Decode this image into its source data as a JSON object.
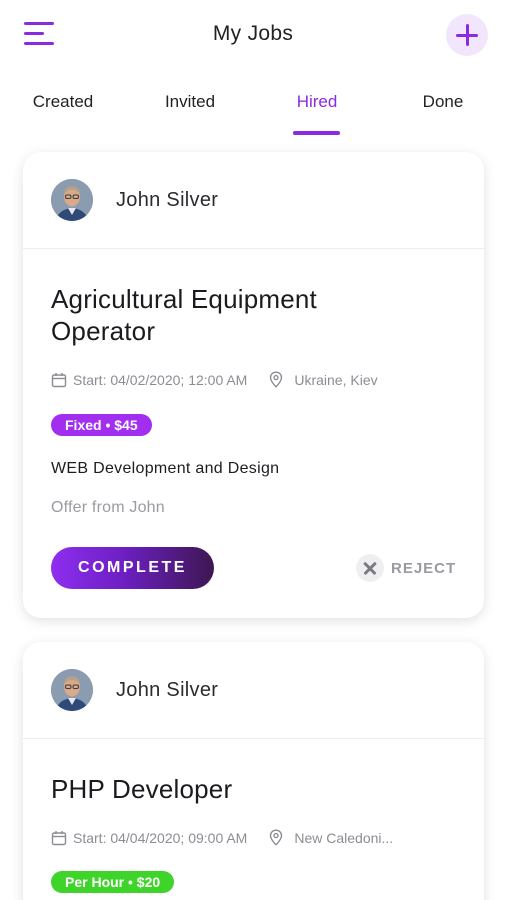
{
  "header": {
    "title": "My Jobs",
    "menu_icon": "hamburger-menu-icon",
    "add_icon": "plus-icon",
    "accent_color": "#8a2be2"
  },
  "tabs": [
    {
      "label": "Created",
      "active": false
    },
    {
      "label": "Invited",
      "active": false
    },
    {
      "label": "Hired",
      "active": true
    },
    {
      "label": "Done",
      "active": false
    }
  ],
  "jobs": [
    {
      "client_name": "John Silver",
      "title_line1": "Agricultural Equipment",
      "title_line2": "Operator",
      "start": "Start: 04/02/2020; 12:00 AM",
      "location": "Ukraine, Kiev",
      "badge": "Fixed • $45",
      "badge_color": "#a22ff0",
      "category": "WEB Development and Design",
      "offer": "Offer from John",
      "complete_label": "COMPLETE",
      "reject_label": "REJECT"
    },
    {
      "client_name": "John Silver",
      "title_line1": "PHP Developer",
      "start": "Start: 04/04/2020; 09:00 AM",
      "location": "New Caledoni...",
      "badge": "Per Hour • $20",
      "badge_color": "#3fd42a"
    }
  ]
}
